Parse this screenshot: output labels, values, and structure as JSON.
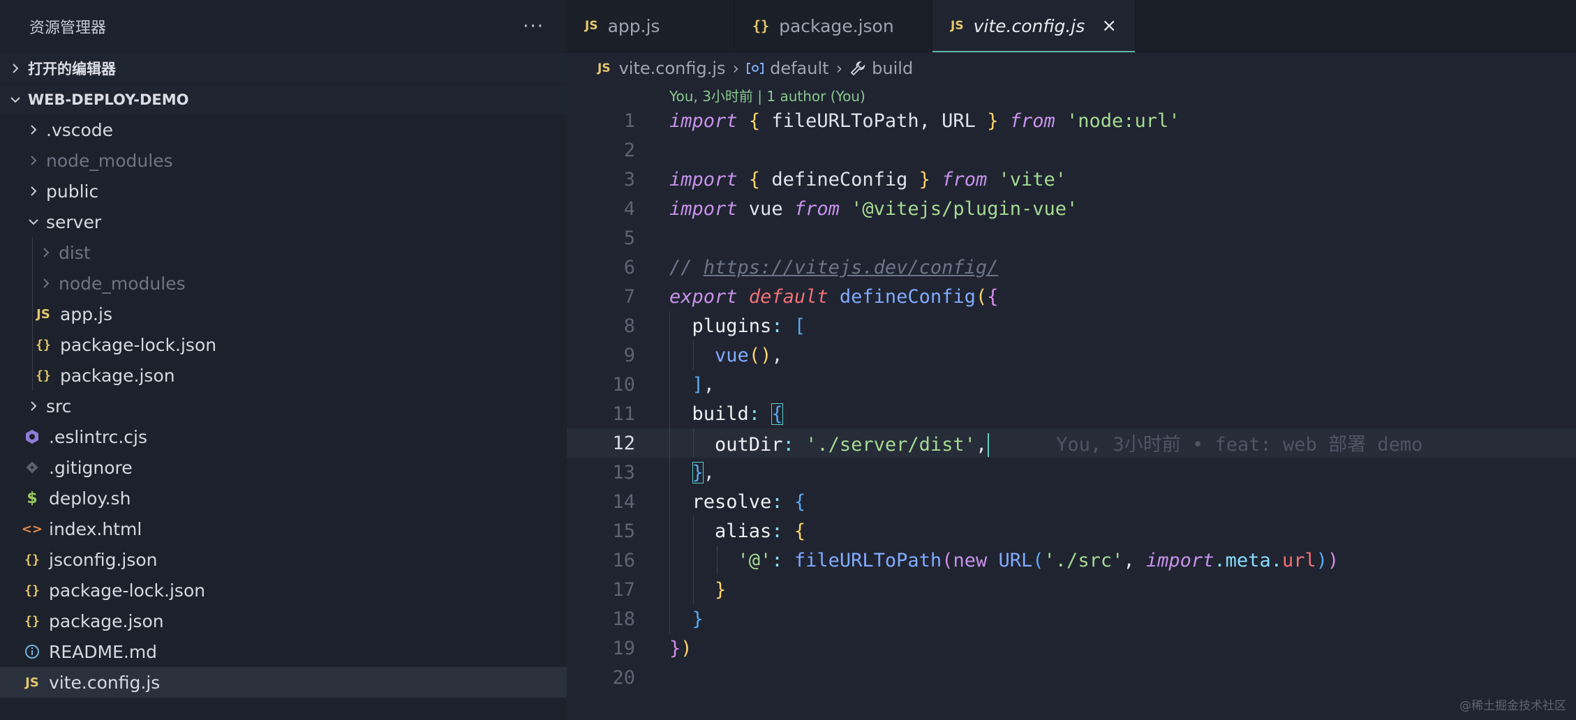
{
  "sidebar": {
    "title": "资源管理器",
    "more": "···",
    "open_editors": "打开的编辑器",
    "project": "WEB-DEPLOY-DEMO",
    "items": [
      {
        "label": ".vscode"
      },
      {
        "label": "node_modules"
      },
      {
        "label": "public"
      },
      {
        "label": "server"
      },
      {
        "label": "dist"
      },
      {
        "label": "node_modules"
      },
      {
        "label": "app.js"
      },
      {
        "label": "package-lock.json"
      },
      {
        "label": "package.json"
      },
      {
        "label": "src"
      },
      {
        "label": ".eslintrc.cjs"
      },
      {
        "label": ".gitignore"
      },
      {
        "label": "deploy.sh"
      },
      {
        "label": "index.html"
      },
      {
        "label": "jsconfig.json"
      },
      {
        "label": "package-lock.json"
      },
      {
        "label": "package.json"
      },
      {
        "label": "README.md"
      },
      {
        "label": "vite.config.js"
      }
    ]
  },
  "icons": {
    "js": "JS",
    "json": "{}",
    "eslint": "eslint-icon",
    "git": "git-icon",
    "shell": "$",
    "html": "<>",
    "info": "info-icon"
  },
  "tabs": [
    {
      "label": "app.js"
    },
    {
      "label": "package.json"
    },
    {
      "label": "vite.config.js"
    }
  ],
  "tab_close": "×",
  "breadcrumb": {
    "file": "vite.config.js",
    "symbol1": "default",
    "symbol2": "build",
    "sep": "›"
  },
  "blame": {
    "top": "You, 3小时前 | 1 author (You)",
    "inline": "You, 3小时前 • feat: web 部署 demo"
  },
  "line_numbers": [
    "1",
    "2",
    "3",
    "4",
    "5",
    "6",
    "7",
    "8",
    "9",
    "10",
    "11",
    "12",
    "13",
    "14",
    "15",
    "16",
    "17",
    "18",
    "19",
    "20"
  ],
  "current_line": 12,
  "watermark": "@稀土掘金技术社区",
  "colors": {
    "accent": "#5fb4a8",
    "keyword": "#c792ea",
    "string": "#a6d993",
    "function": "#82aaff"
  }
}
